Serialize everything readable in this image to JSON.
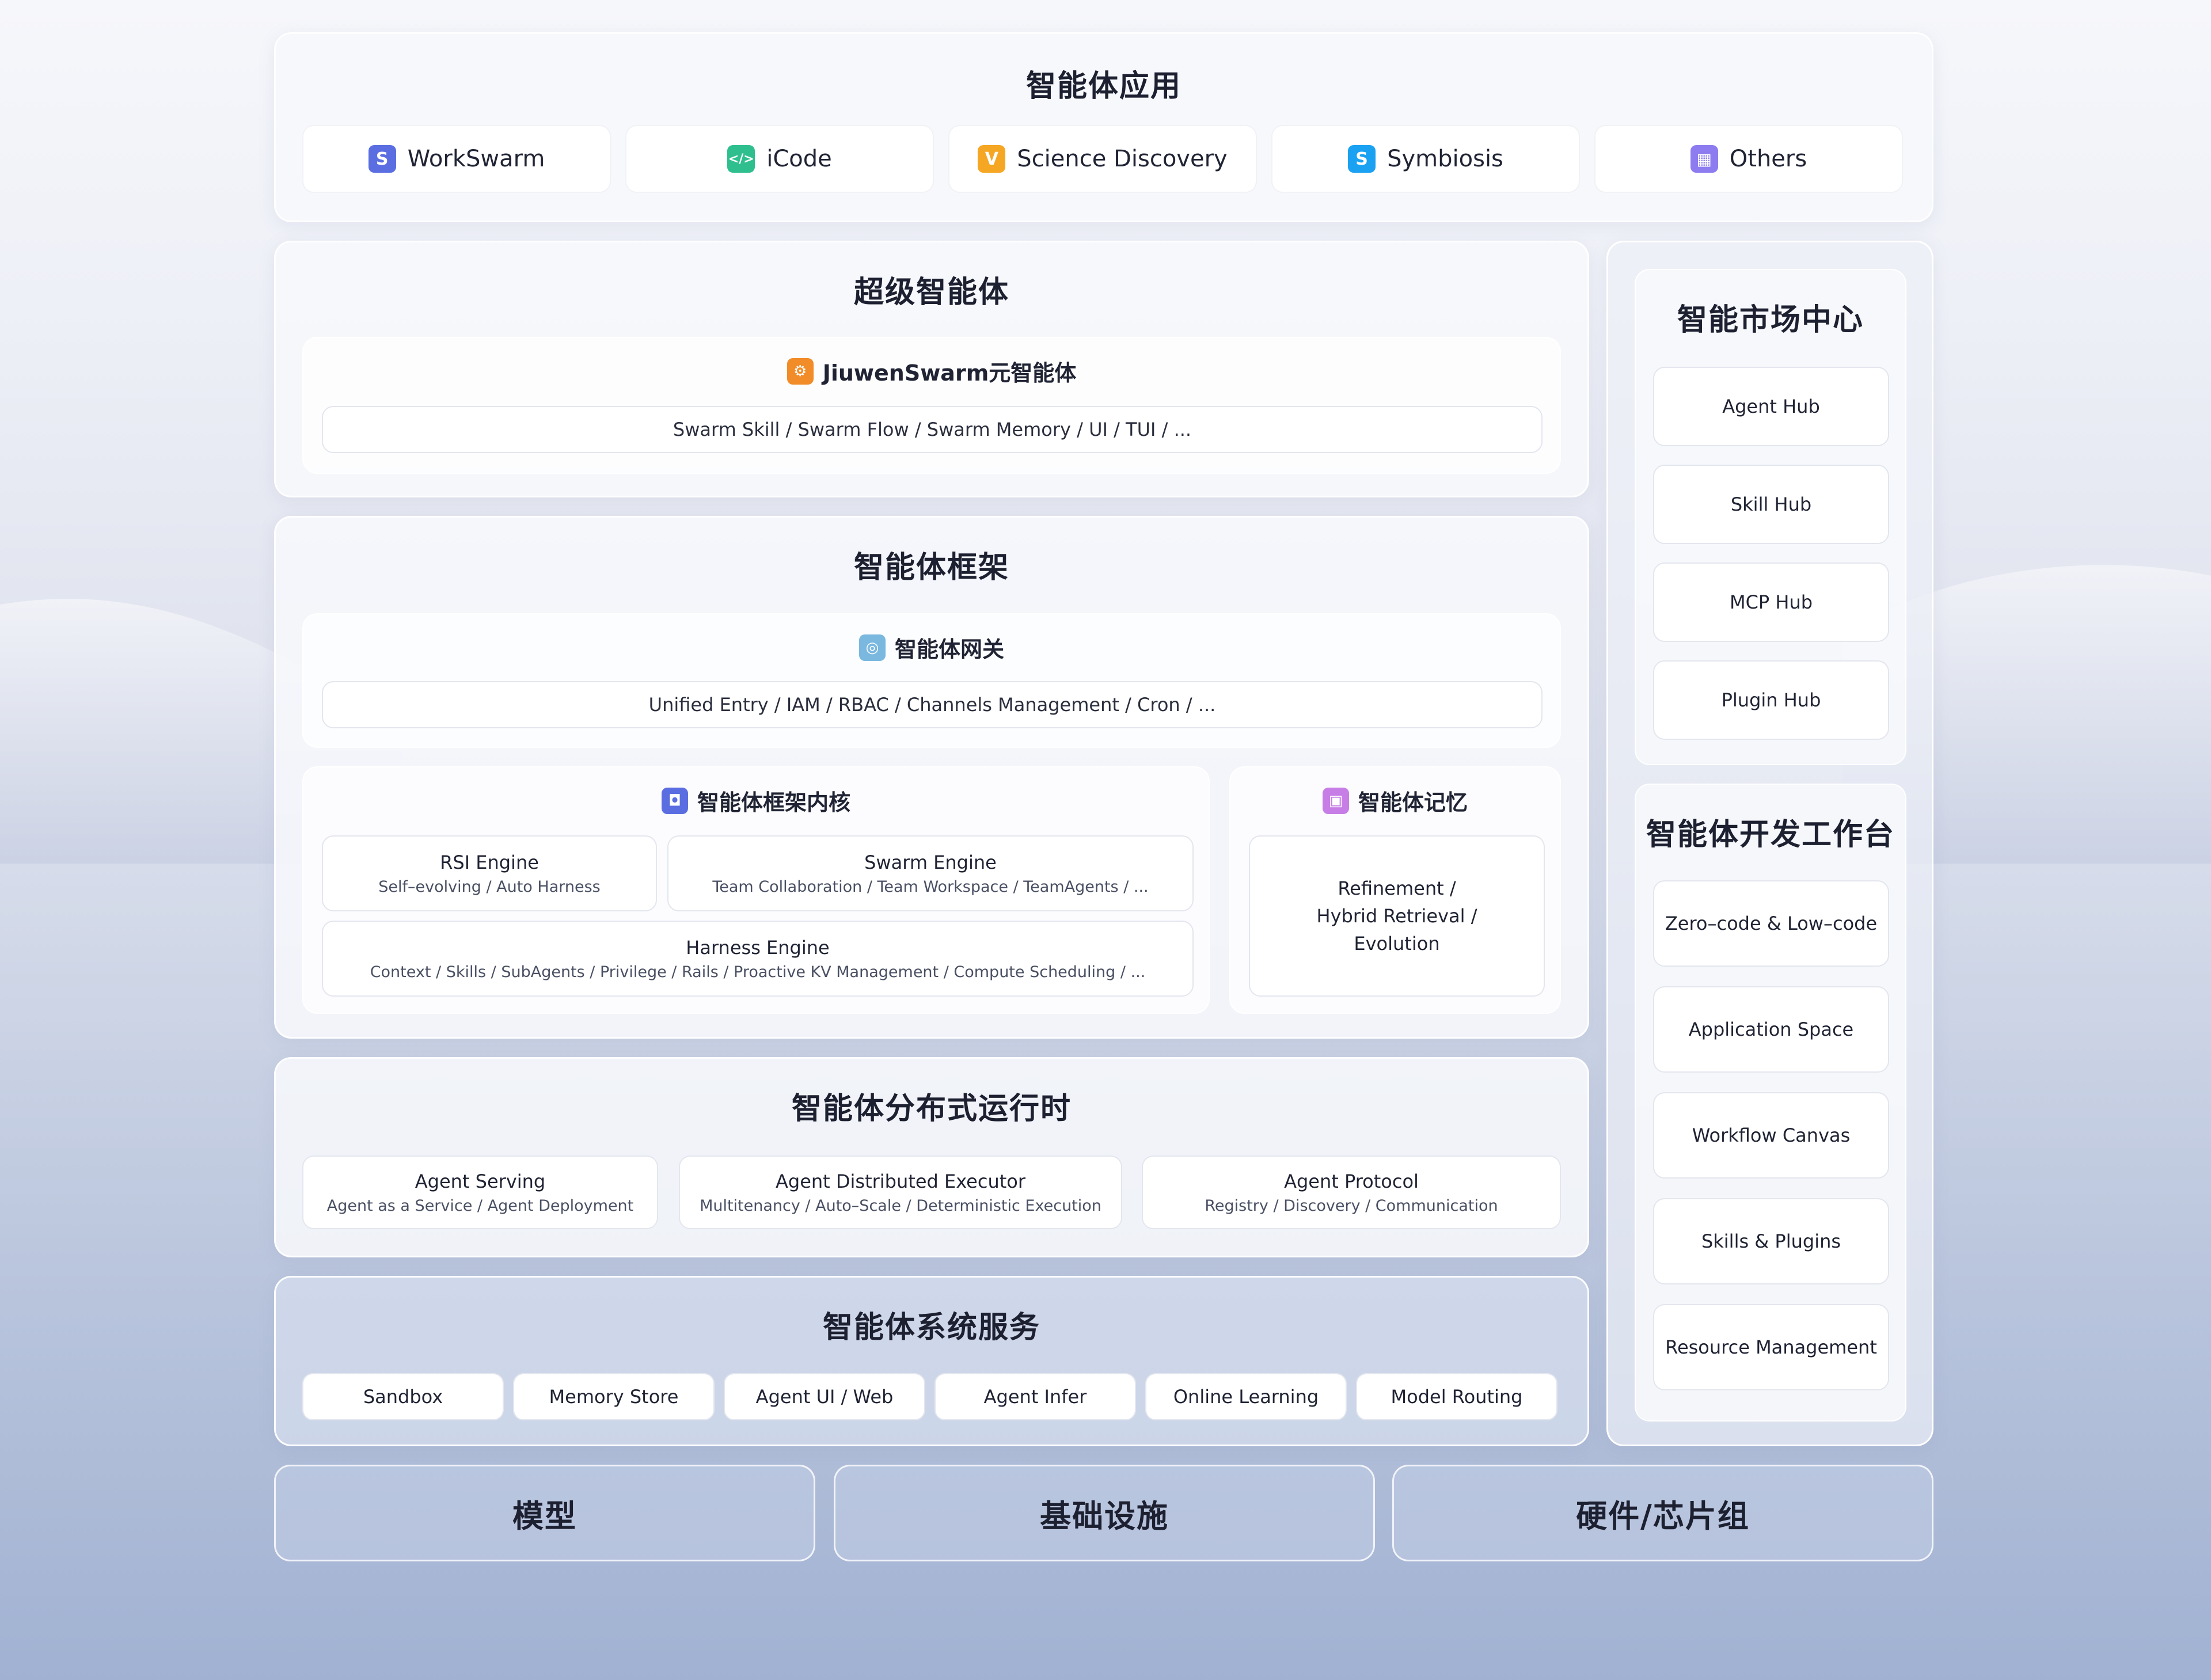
{
  "apps": {
    "title": "智能体应用",
    "items": [
      {
        "label": "WorkSwarm",
        "icon": "S",
        "color": "#5b6ee1"
      },
      {
        "label": "iCode",
        "icon": "</>",
        "color": "#2fbf8f"
      },
      {
        "label": "Science Discovery",
        "icon": "V",
        "color": "#f5a623"
      },
      {
        "label": "Symbiosis",
        "icon": "S",
        "color": "#1ba1f2"
      },
      {
        "label": "Others",
        "icon": "▦",
        "color": "#8c7cf0"
      }
    ]
  },
  "super_agent": {
    "title": "超级智能体",
    "swarm_title": "JiuwenSwarm元智能体",
    "swarm_detail": "Swarm Skill / Swarm Flow / Swarm Memory / UI / TUI / ..."
  },
  "framework": {
    "title": "智能体框架",
    "gateway_title": "智能体网关",
    "gateway_detail": "Unified Entry / IAM / RBAC / Channels Management / Cron / ...",
    "kernel_title": "智能体框架内核",
    "rsi_title": "RSI Engine",
    "rsi_detail": "Self–evolving / Auto Harness",
    "swarm_engine_title": "Swarm Engine",
    "swarm_engine_detail": "Team Collaboration / Team Workspace / TeamAgents / ...",
    "harness_title": "Harness Engine",
    "harness_detail": "Context / Skills / SubAgents / Privilege / Rails / Proactive KV Management / Compute Scheduling / ...",
    "memory_title": "智能体记忆",
    "memory_line1": "Refinement /",
    "memory_line2": "Hybrid Retrieval /",
    "memory_line3": "Evolution"
  },
  "runtime": {
    "title": "智能体分布式运行时",
    "items": [
      {
        "title": "Agent Serving",
        "detail": "Agent as a Service / Agent Deployment"
      },
      {
        "title": "Agent Distributed Executor",
        "detail": "Multitenancy / Auto–Scale / Deterministic Execution"
      },
      {
        "title": "Agent Protocol",
        "detail": "Registry / Discovery / Communication"
      }
    ]
  },
  "services": {
    "title": "智能体系统服务",
    "items": [
      "Sandbox",
      "Memory Store",
      "Agent UI / Web",
      "Agent Infer",
      "Online Learning",
      "Model Routing"
    ]
  },
  "bottom": {
    "items": [
      "模型",
      "基础设施",
      "硬件/芯片组"
    ]
  },
  "market": {
    "title": "智能市场中心",
    "items": [
      "Agent Hub",
      "Skill Hub",
      "MCP Hub",
      "Plugin Hub"
    ]
  },
  "workbench": {
    "title": "智能体开发工作台",
    "items": [
      "Zero–code & Low–code",
      "Application Space",
      "Workflow Canvas",
      "Skills & Plugins",
      "Resource Management"
    ]
  },
  "colors": {
    "swarm_icon": "#f28c28",
    "gateway_icon": "#7ab8e0",
    "kernel_icon": "#5b6ee1",
    "memory_icon": "#c67ee6"
  }
}
